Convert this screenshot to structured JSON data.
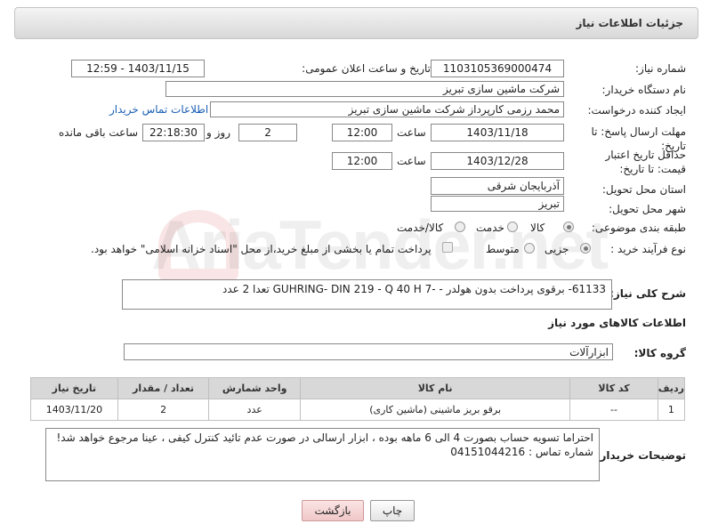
{
  "header": {
    "title": "جزئیات اطلاعات نیاز"
  },
  "fields": {
    "need_number_label": "شماره نیاز:",
    "need_number": "1103105369000474",
    "announce_label": "تاریخ و ساعت اعلان عمومی:",
    "announce_value": "1403/11/15 - 12:59",
    "buyer_org_label": "نام دستگاه خریدار:",
    "buyer_org": "شرکت ماشین سازی تبریز",
    "requester_label": "ایجاد کننده درخواست:",
    "requester": "محمد رزمی کارپرداز شرکت ماشین سازی تبریز",
    "contact_link": "اطلاعات تماس خریدار",
    "deadline_label": "مهلت ارسال پاسخ: تا تاریخ:",
    "deadline_date": "1403/11/18",
    "time_label": "ساعت",
    "deadline_time": "12:00",
    "days_value": "2",
    "days_label": "روز و",
    "remaining_time": "22:18:30",
    "remaining_label": "ساعت باقی مانده",
    "price_validity_label": "حداقل تاریخ اعتبار قیمت: تا تاریخ:",
    "price_validity_date": "1403/12/28",
    "price_validity_time": "12:00",
    "province_label": "استان محل تحویل:",
    "province": "آذربایجان شرقی",
    "city_label": "شهر محل تحویل:",
    "city": "تبریز",
    "category_label": "طبقه بندی موضوعی:",
    "category_options": [
      "کالا",
      "خدمت",
      "کالا/خدمت"
    ],
    "process_label": "نوع فرآیند خرید :",
    "process_options": [
      "جزیی",
      "متوسط"
    ],
    "payment_note": "پرداخت تمام یا بخشی از مبلغ خرید،از محل \"اسناد خزانه اسلامی\" خواهد بود."
  },
  "description": {
    "label": "شرح کلی نیاز:",
    "text": "61133- برقوی پرداخت بدون هولدر - -GUHRING- DIN 219 - Q 40 H 7  تعدا 2 عدد"
  },
  "goods_info_title": "اطلاعات کالاهای مورد نیاز",
  "goods_group": {
    "label": "گروه کالا:",
    "value": "ابزارآلات"
  },
  "table": {
    "headers": [
      "ردیف",
      "کد کالا",
      "نام کالا",
      "واحد شمارش",
      "تعداد / مقدار",
      "تاریخ نیاز"
    ],
    "rows": [
      [
        "1",
        "--",
        "برقو بریز ماشینی (ماشین کاری)",
        "عدد",
        "2",
        "1403/11/20"
      ]
    ]
  },
  "buyer_notes": {
    "label": "توضیحات خریدار:",
    "line1": "احتراما تسویه حساب بصورت 4 الی 6 ماهه بوده ، ابزار ارسالی در صورت عدم تائید کنترل کیفی ، عینا مرجوع خواهد شد!",
    "line2": "شماره تماس : 04151044216"
  },
  "buttons": {
    "print": "چاپ",
    "back": "بازگشت"
  },
  "watermark": {
    "text": "AriaTender.net"
  }
}
